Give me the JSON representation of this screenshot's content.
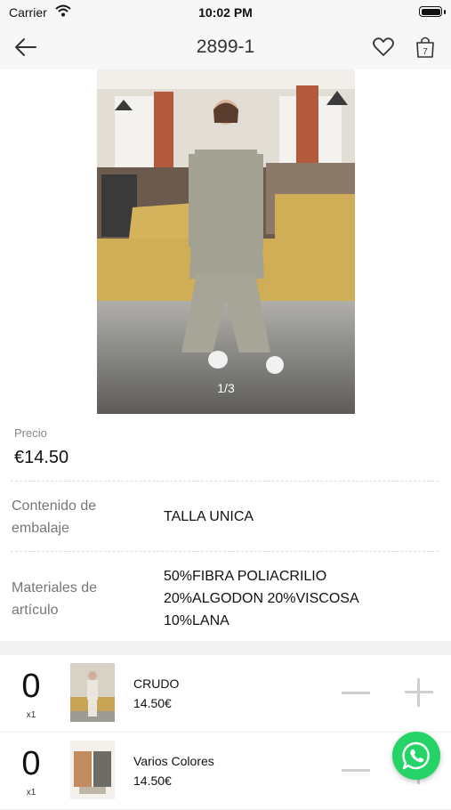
{
  "status_bar": {
    "carrier": "Carrier",
    "time": "10:02 PM"
  },
  "nav": {
    "title": "2899-1",
    "cart_count": "7"
  },
  "gallery": {
    "counter": "1/3"
  },
  "price": {
    "label": "Precio",
    "value": "€14.50"
  },
  "specs": [
    {
      "label": "Contenido de embalaje",
      "value": "TALLA UNICA"
    },
    {
      "label": "Materiales de artículo",
      "value": "50%FIBRA POLIACRILIO 20%ALGODON 20%VISCOSA 10%LANA"
    }
  ],
  "variants": [
    {
      "quantity": "0",
      "multiplier": "x1",
      "name": "CRUDO",
      "price": "14.50€"
    },
    {
      "quantity": "0",
      "multiplier": "x1",
      "name": "Varios Colores",
      "price": "14.50€"
    }
  ],
  "colors": {
    "accent_green": "#25d366",
    "divider": "#dcdcdc",
    "stepper": "#cfcfcf"
  },
  "icons": [
    "back-arrow-icon",
    "heart-icon",
    "cart-icon",
    "wifi-icon",
    "battery-icon",
    "whatsapp-icon"
  ]
}
